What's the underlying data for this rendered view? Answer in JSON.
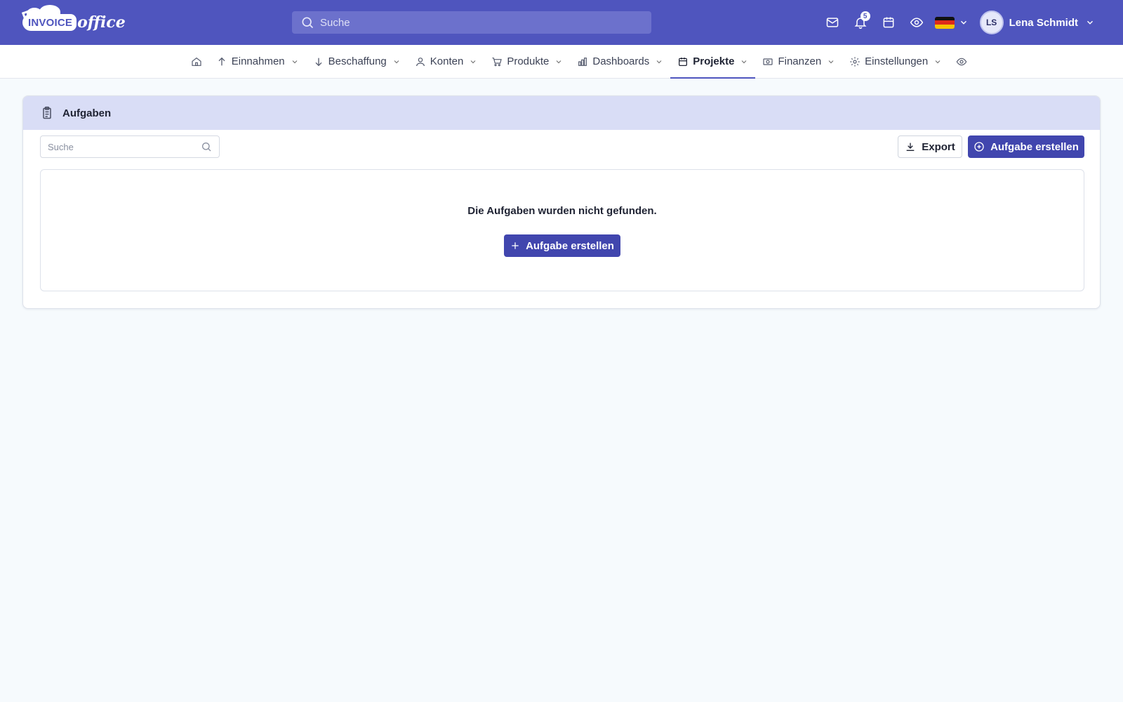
{
  "brand": {
    "logo_text_1": "INVOICE",
    "logo_text_2": "office",
    "accent": "#4f55be"
  },
  "header": {
    "search_placeholder": "Suche",
    "notifications_count": "5",
    "user": {
      "initials": "LS",
      "name": "Lena Schmidt"
    },
    "icons": [
      "mail-icon",
      "bell-icon",
      "calendar-icon",
      "eye-icon",
      "flag-de-icon",
      "chevron-down-icon"
    ]
  },
  "nav": {
    "items": [
      {
        "label": "Einnahmen",
        "icon": "arrow-up-icon"
      },
      {
        "label": "Beschaffung",
        "icon": "arrow-down-icon"
      },
      {
        "label": "Konten",
        "icon": "user-icon"
      },
      {
        "label": "Produkte",
        "icon": "cart-icon"
      },
      {
        "label": "Dashboards",
        "icon": "chart-icon"
      },
      {
        "label": "Projekte",
        "icon": "calendar-icon",
        "active": true
      },
      {
        "label": "Finanzen",
        "icon": "money-icon"
      },
      {
        "label": "Einstellungen",
        "icon": "gear-icon"
      }
    ]
  },
  "page": {
    "title": "Aufgaben",
    "search_placeholder": "Suche",
    "export_label": "Export",
    "create_label": "Aufgabe erstellen",
    "empty_message": "Die Aufgaben wurden nicht gefunden.",
    "empty_create_label": "Aufgabe erstellen"
  }
}
